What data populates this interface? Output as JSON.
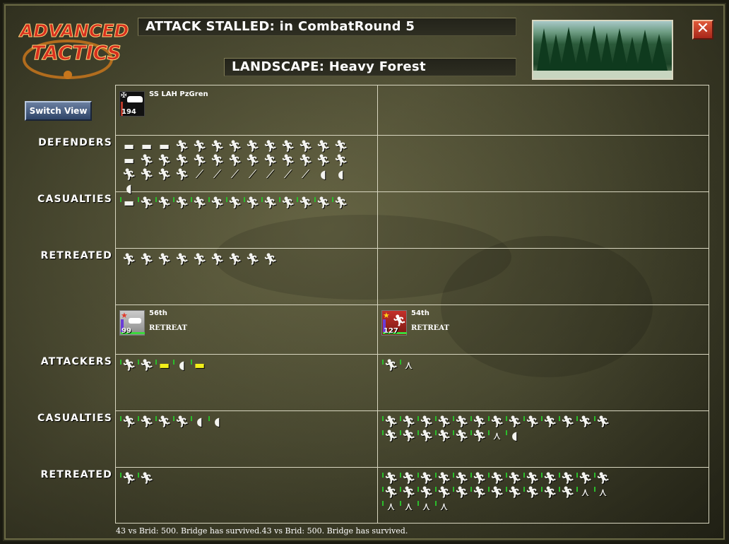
{
  "header": {
    "logo_line1": "ADVANCED",
    "logo_line2": "TACTICS",
    "title": "ATTACK STALLED: in CombatRound  5",
    "landscape": "LANDSCAPE: Heavy Forest",
    "close_label": "✕",
    "switch_view_label": "Switch View"
  },
  "labels": {
    "defenders": "DEFENDERS",
    "def_casualties": "CASUALTIES",
    "def_retreated": "RETREATED",
    "attackers": "ATTACKERS",
    "att_casualties": "CASUALTIES",
    "att_retreated": "RETREATED"
  },
  "defender_units": [
    {
      "name": "SS LAH PzGren",
      "strength": "194",
      "icon": "tank-icon",
      "flag": "iron-cross-icon",
      "status": ""
    }
  ],
  "attacker_units": [
    {
      "name": "56th",
      "strength": "99",
      "icon": "tank-icon",
      "flag": "soviet-star-icon",
      "status": "RETREAT"
    },
    {
      "name": "54th",
      "strength": "127",
      "icon": "infantry-icon",
      "flag": "soviet-star-icon",
      "status": "RETREAT"
    }
  ],
  "colors": {
    "panel_border": "#d8d6c0",
    "green_tick": "#2bbd2b",
    "yellow_unit": "#f3ef1a",
    "close_red": "#c0382a",
    "switch_blue": "#3e5678"
  },
  "figures": {
    "def_defenders": [
      "tank",
      "tank",
      "tank",
      "soldier",
      "soldier",
      "soldier",
      "soldier",
      "soldier",
      "soldier",
      "soldier",
      "soldier",
      "soldier",
      "soldier",
      "tank",
      "soldier",
      "soldier",
      "soldier",
      "soldier",
      "soldier",
      "soldier",
      "soldier",
      "soldier",
      "soldier",
      "soldier",
      "soldier",
      "soldier",
      "soldier",
      "soldier",
      "soldier",
      "soldier",
      "gun",
      "gun",
      "gun",
      "gun",
      "gun",
      "gun",
      "gun",
      "car",
      "car",
      "car"
    ],
    "def_casualties": [
      "tank",
      "soldier",
      "soldier",
      "soldier",
      "soldier",
      "soldier",
      "soldier",
      "soldier",
      "soldier",
      "soldier",
      "soldier",
      "soldier",
      "soldier"
    ],
    "def_retreated": [
      "soldier",
      "soldier",
      "soldier",
      "soldier",
      "soldier",
      "soldier",
      "soldier",
      "soldier",
      "soldier"
    ],
    "att56_attackers": [
      "rifleman",
      "rifleman",
      "yellow-tank",
      "car",
      "yellow-tank"
    ],
    "att56_casualties": [
      "rifleman",
      "rifleman",
      "rifleman",
      "rifleman",
      "car",
      "car"
    ],
    "att56_retreated": [
      "rifleman",
      "rifleman"
    ],
    "att54_attackers": [
      "rifleman",
      "mortar"
    ],
    "att54_casualties": [
      "rifleman",
      "rifleman",
      "rifleman",
      "rifleman",
      "rifleman",
      "rifleman",
      "rifleman",
      "rifleman",
      "rifleman",
      "rifleman",
      "rifleman",
      "rifleman",
      "rifleman",
      "rifleman",
      "rifleman",
      "rifleman",
      "rifleman",
      "rifleman",
      "rifleman",
      "mortar",
      "car"
    ],
    "att54_retreated": [
      "rifleman",
      "rifleman",
      "rifleman",
      "rifleman",
      "rifleman",
      "rifleman",
      "rifleman",
      "rifleman",
      "rifleman",
      "rifleman",
      "rifleman",
      "rifleman",
      "rifleman",
      "rifleman",
      "rifleman",
      "rifleman",
      "rifleman",
      "rifleman",
      "rifleman",
      "rifleman",
      "rifleman",
      "rifleman",
      "rifleman",
      "rifleman",
      "mortar",
      "mortar",
      "mortar",
      "mortar",
      "mortar",
      "mortar"
    ]
  },
  "footer": "43 vs Brid: 500. Bridge has survived.43 vs Brid: 500. Bridge has survived."
}
